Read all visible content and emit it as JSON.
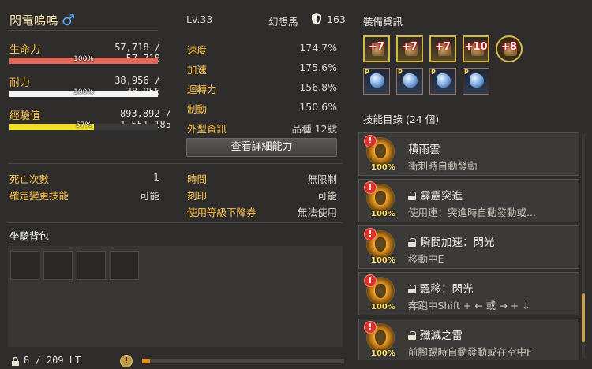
{
  "character": {
    "name": "閃電嗚嗚",
    "gender_symbol": "♂",
    "level": "Lv.33",
    "mount_label": "幻想馬",
    "mount_value": "163"
  },
  "vitals": {
    "hp_label": "生命力",
    "hp_value": "57,718 / 57,718",
    "hp_pct_text": "100%",
    "hp_fraction": 1.0,
    "hp_color": "#e2685a",
    "stamina_label": "耐力",
    "stamina_value": "38,956 / 38,956",
    "stamina_pct_text": "100%",
    "stamina_fraction": 1.0,
    "stamina_color": "#f4f4f4",
    "exp_label": "經驗值",
    "exp_value": "893,892 / 1,551,185",
    "exp_pct_text": "57%",
    "exp_fraction": 0.57,
    "exp_color": "#f0e020"
  },
  "abilities": [
    {
      "label": "速度",
      "value": "174.7%"
    },
    {
      "label": "加速",
      "value": "175.6%"
    },
    {
      "label": "迴轉力",
      "value": "156.8%"
    },
    {
      "label": "制動",
      "value": "150.6%"
    },
    {
      "label": "外型資訊",
      "value": "品種 12號"
    }
  ],
  "detail_button": "查看詳細能力",
  "status_left": [
    {
      "label": "死亡次數",
      "value": "1"
    },
    {
      "label": "確定變更技能",
      "value": "可能"
    }
  ],
  "status_right": [
    {
      "label": "時間",
      "value": "無限制"
    },
    {
      "label": "刻印",
      "value": "可能"
    },
    {
      "label": "使用等級下降券",
      "value": "無法使用"
    }
  ],
  "bag": {
    "title": "坐騎背包",
    "count": "8 / 209 LT",
    "fill_fraction": 0.04,
    "fill_color": "#e09020"
  },
  "equipment": {
    "title": "裝備資訊",
    "top_row": [
      "+7",
      "+7",
      "+7",
      "+10",
      "+8"
    ],
    "bottom_row": [
      "P",
      "P",
      "P",
      "P",
      ""
    ]
  },
  "skills": {
    "title": "技能目錄 (24 個)",
    "items": [
      {
        "alert": "!",
        "pct": "100%",
        "name": "積雨雲",
        "locked": false,
        "desc": "衝刺時自動發動"
      },
      {
        "alert": "!",
        "pct": "100%",
        "name": "霹靂突進",
        "locked": true,
        "desc": "使用連：突進時自動發動或..."
      },
      {
        "alert": "!",
        "pct": "100%",
        "name": "瞬間加速：閃光",
        "locked": true,
        "desc": "移動中E"
      },
      {
        "alert": "!",
        "pct": "100%",
        "name": "飄移：閃光",
        "locked": true,
        "desc": "奔跑中Shift + ← 或 → + ↓"
      },
      {
        "alert": "!",
        "pct": "100%",
        "name": "殲滅之雷",
        "locked": true,
        "desc": "前腳踢時自動發動或在空中F"
      }
    ]
  }
}
